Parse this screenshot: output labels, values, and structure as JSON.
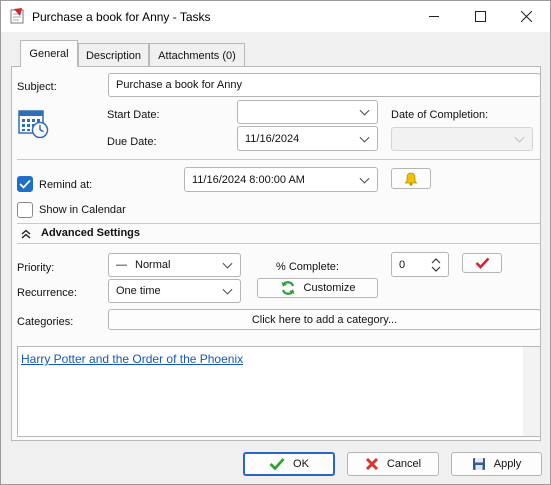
{
  "window": {
    "title": "Purchase a book for Anny - Tasks",
    "controls": [
      "minimize",
      "maximize",
      "close"
    ]
  },
  "tabs": [
    {
      "label": "General",
      "active": true
    },
    {
      "label": "Description",
      "active": false
    },
    {
      "label": "Attachments (0)",
      "active": false
    }
  ],
  "general": {
    "subject_label": "Subject:",
    "subject_value": "Purchase a book for Anny",
    "start_date_label": "Start Date:",
    "start_date_value": "",
    "due_date_label": "Due Date:",
    "due_date_value": "11/16/2024",
    "completion_label": "Date of Completion:",
    "completion_value": "",
    "remind_label": "Remind at:",
    "remind_checked": true,
    "remind_value": "11/16/2024 8:00:00 AM",
    "show_calendar_label": "Show in Calendar",
    "show_calendar_checked": false
  },
  "advanced": {
    "header": "Advanced Settings",
    "priority_label": "Priority:",
    "priority_value": "Normal",
    "complete_label": "% Complete:",
    "complete_value": "0",
    "recurrence_label": "Recurrence:",
    "recurrence_value": "One time",
    "customize_label": "Customize",
    "categories_label": "Categories:",
    "categories_button": "Click here to add a category..."
  },
  "notes": {
    "link_text": "Harry Potter and the Order of the Phoenix"
  },
  "footer": {
    "ok_label": "OK",
    "cancel_label": "Cancel",
    "apply_label": "Apply"
  },
  "colors": {
    "accent": "#1f6fc5",
    "link": "#1556c0",
    "ok_check": "#2fa42f",
    "cancel_x": "#d8362a",
    "mark_red": "#d8232a",
    "bell": "#f2c200",
    "refresh": "#2a9d3a"
  }
}
